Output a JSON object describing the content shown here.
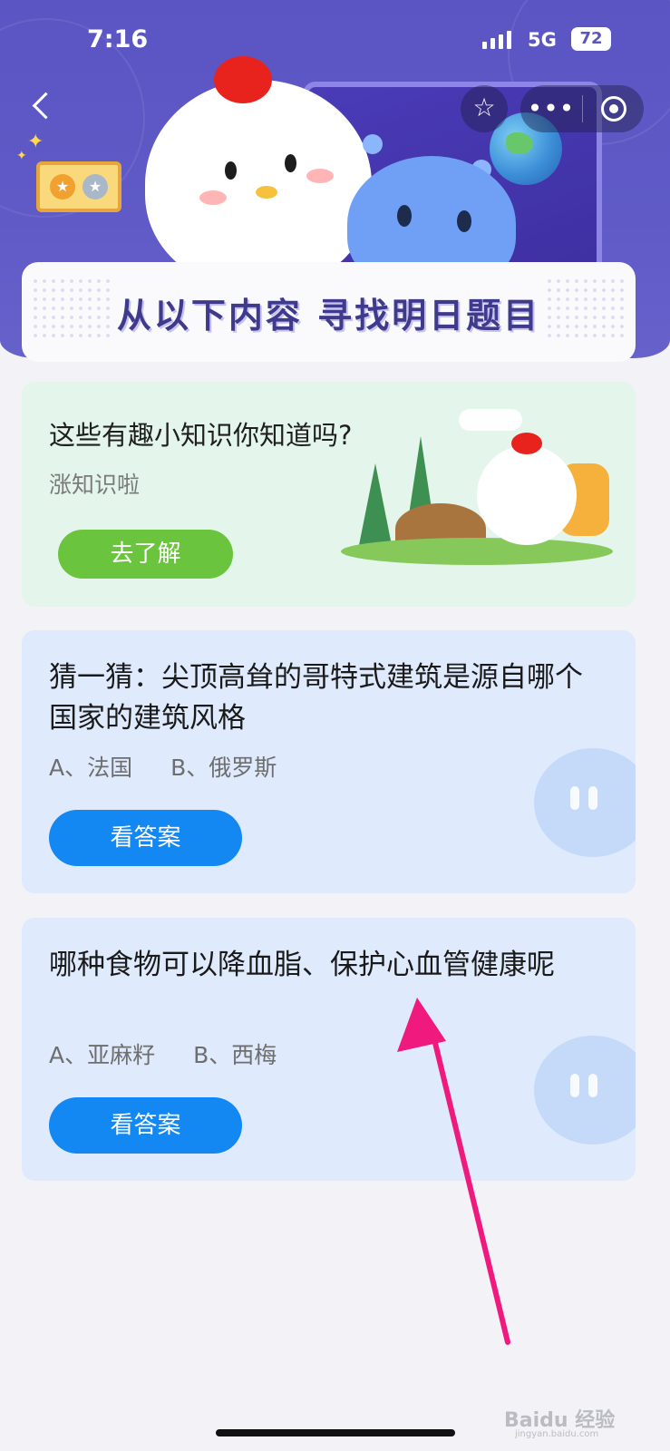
{
  "status_bar": {
    "time": "7:16",
    "network": "5G",
    "battery": "72"
  },
  "header": {
    "banner_title": "从以下内容 寻找明日题目",
    "more_icon_label": "•••"
  },
  "fun_card": {
    "title": "这些有趣小知识你知道吗?",
    "subtitle": "涨知识啦",
    "button_label": "去了解"
  },
  "quiz_cards": [
    {
      "question": "猜一猜：尖顶高耸的哥特式建筑是源自哪个国家的建筑风格",
      "option_a": "A、法国",
      "option_b": "B、俄罗斯",
      "button_label": "看答案"
    },
    {
      "question": "哪种食物可以降血脂、保护心血管健康呢",
      "option_a": "A、亚麻籽",
      "option_b": "B、西梅",
      "button_label": "看答案"
    }
  ],
  "watermark": {
    "brand": "Baidu 经验",
    "url": "jingyan.baidu.com"
  },
  "colors": {
    "header_purple": "#5b55c4",
    "fun_card_bg": "#e4f5eb",
    "green_button": "#6bc43d",
    "quiz_card_bg": "#dfeafd",
    "blue_button": "#1388f2",
    "arrow": "#f0197d"
  }
}
